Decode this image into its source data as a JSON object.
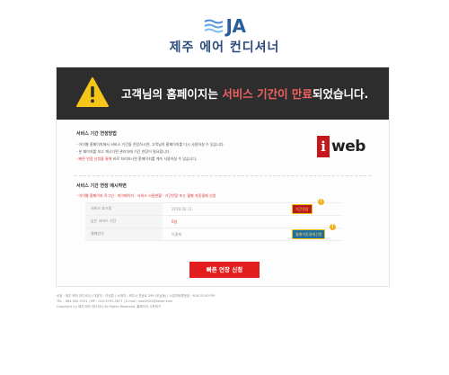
{
  "logo": {
    "mark": "JA",
    "name": "제주 에어 컨디셔너"
  },
  "banner": {
    "prefix": "고객님의 홈페이지는 ",
    "highlight": "서비스 기간이 만료",
    "suffix": "되었습니다."
  },
  "section1": {
    "title": "서비스 기간 연장방법",
    "items": [
      "· 아이웹 홈페이지에서 서비스 기간을 연장하시면, 고객님의 홈페이지를 다시 사용하실 수 있습니다.",
      "· 본 페이지를 보고 계시다면 관리자에 기간 연장이 필요합니다.",
      "· 빠른 연장 신청을 통해 바로 처리하시면 홈페이지를 계속 사용하실 수 있습니다."
    ],
    "item3_red": "· 빠른 연장 신청을 통해",
    "item3_rest": " 바로 처리하시면 홈페이지를 계속 사용하실 수 있습니다."
  },
  "brand": {
    "box_letter": "i",
    "word": "web"
  },
  "section2": {
    "title": "서비스 기간 연장 메시하면",
    "steps": "· 아이웹 홈페이지 로그인 · 마이페이지 · 서비스 사용현황 · 기간연장 또는 월별 자동결제 신청"
  },
  "table": {
    "rows": [
      {
        "label": "서비스 호스팅",
        "value": "2019.02.11",
        "button": "기간연장"
      },
      {
        "label": "남은 서비스 기간",
        "value": "0일",
        "button": ""
      },
      {
        "label": "결제방식",
        "value": "미결제",
        "button": "월별자동결제신청"
      }
    ]
  },
  "cta": {
    "label": "빠른 연장 신청"
  },
  "footer": {
    "lines": [
      "상호 : 제주 에어 컨디셔너 | 대표자 : 이성훈 | 소재지 : 제주시 연삼로 299 (도남동) | 사업자등록번호 : 616-03-00759",
      "TEL : 064-900-5331 | MP : 010-5791-3677 | E-mail : cool2933@naver.com",
      "Copyright (c) 제주 에어 컨디셔너 All Rights Reserved.      홈페이지 시작하기"
    ]
  },
  "colors": {
    "banner_bg": "#2d2d2d",
    "highlight": "#f06262",
    "accent_red": "#e11d1d",
    "logo_blue": "#2a5d9c"
  },
  "icons": {
    "warning": "warning-triangle-icon",
    "waves": "logo-waves-icon"
  }
}
